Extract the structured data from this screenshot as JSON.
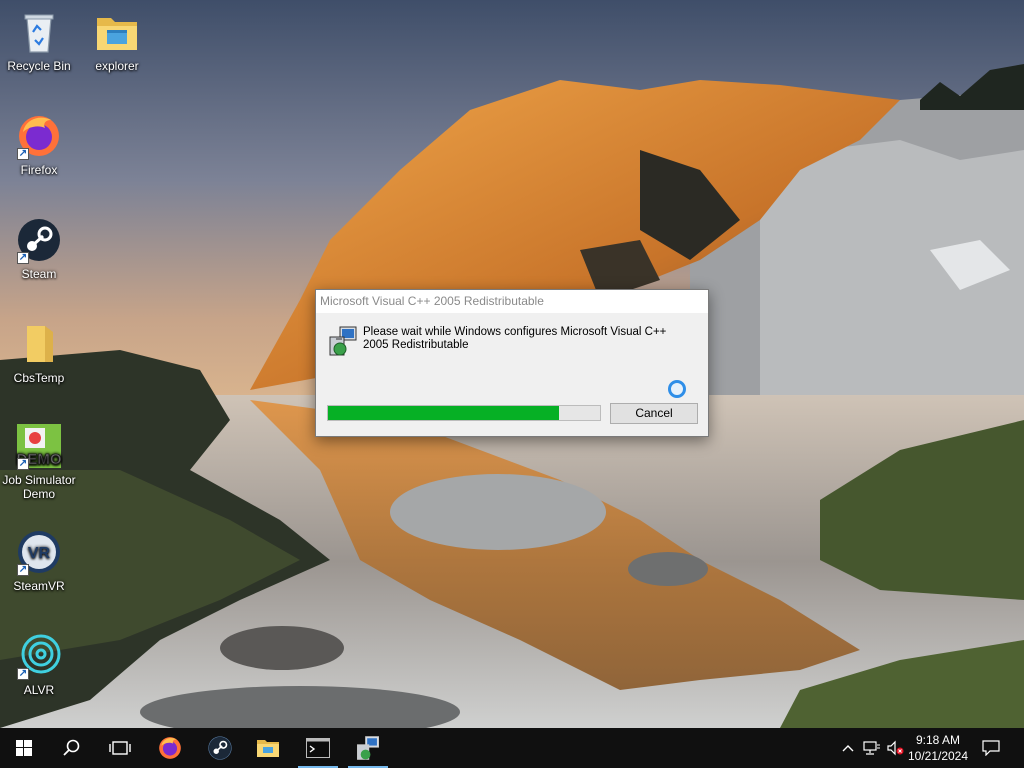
{
  "desktop": {
    "icons": [
      {
        "label": "Recycle Bin",
        "icon": "recycle-bin-icon"
      },
      {
        "label": "explorer",
        "icon": "folder-icon"
      },
      {
        "label": "Firefox",
        "icon": "firefox-icon"
      },
      {
        "label": "Steam",
        "icon": "steam-icon"
      },
      {
        "label": "CbsTemp",
        "icon": "folder-icon"
      },
      {
        "label": "Job Simulator Demo",
        "icon": "job-simulator-icon",
        "art_text": "DEMO"
      },
      {
        "label": "SteamVR",
        "icon": "steamvr-icon",
        "art_text": "VR"
      },
      {
        "label": "ALVR",
        "icon": "alvr-icon"
      }
    ]
  },
  "dialog": {
    "title": "Microsoft Visual C++ 2005 Redistributable",
    "message": "Please wait while Windows configures Microsoft Visual C++ 2005 Redistributable",
    "progress": 0.85,
    "cancel_label": "Cancel",
    "progress_color": "#06b025"
  },
  "taskbar": {
    "items": [
      {
        "name": "start-button",
        "icon": "windows-logo-icon"
      },
      {
        "name": "search-button",
        "icon": "search-icon"
      },
      {
        "name": "task-view-button",
        "icon": "task-view-icon"
      },
      {
        "name": "taskbar-firefox",
        "icon": "firefox-icon"
      },
      {
        "name": "taskbar-steam",
        "icon": "steam-icon"
      },
      {
        "name": "taskbar-explorer",
        "icon": "folder-icon"
      },
      {
        "name": "taskbar-terminal",
        "icon": "terminal-icon"
      },
      {
        "name": "taskbar-installer",
        "icon": "installer-icon"
      }
    ],
    "tray": {
      "time": "9:18 AM",
      "date": "10/21/2024"
    }
  }
}
